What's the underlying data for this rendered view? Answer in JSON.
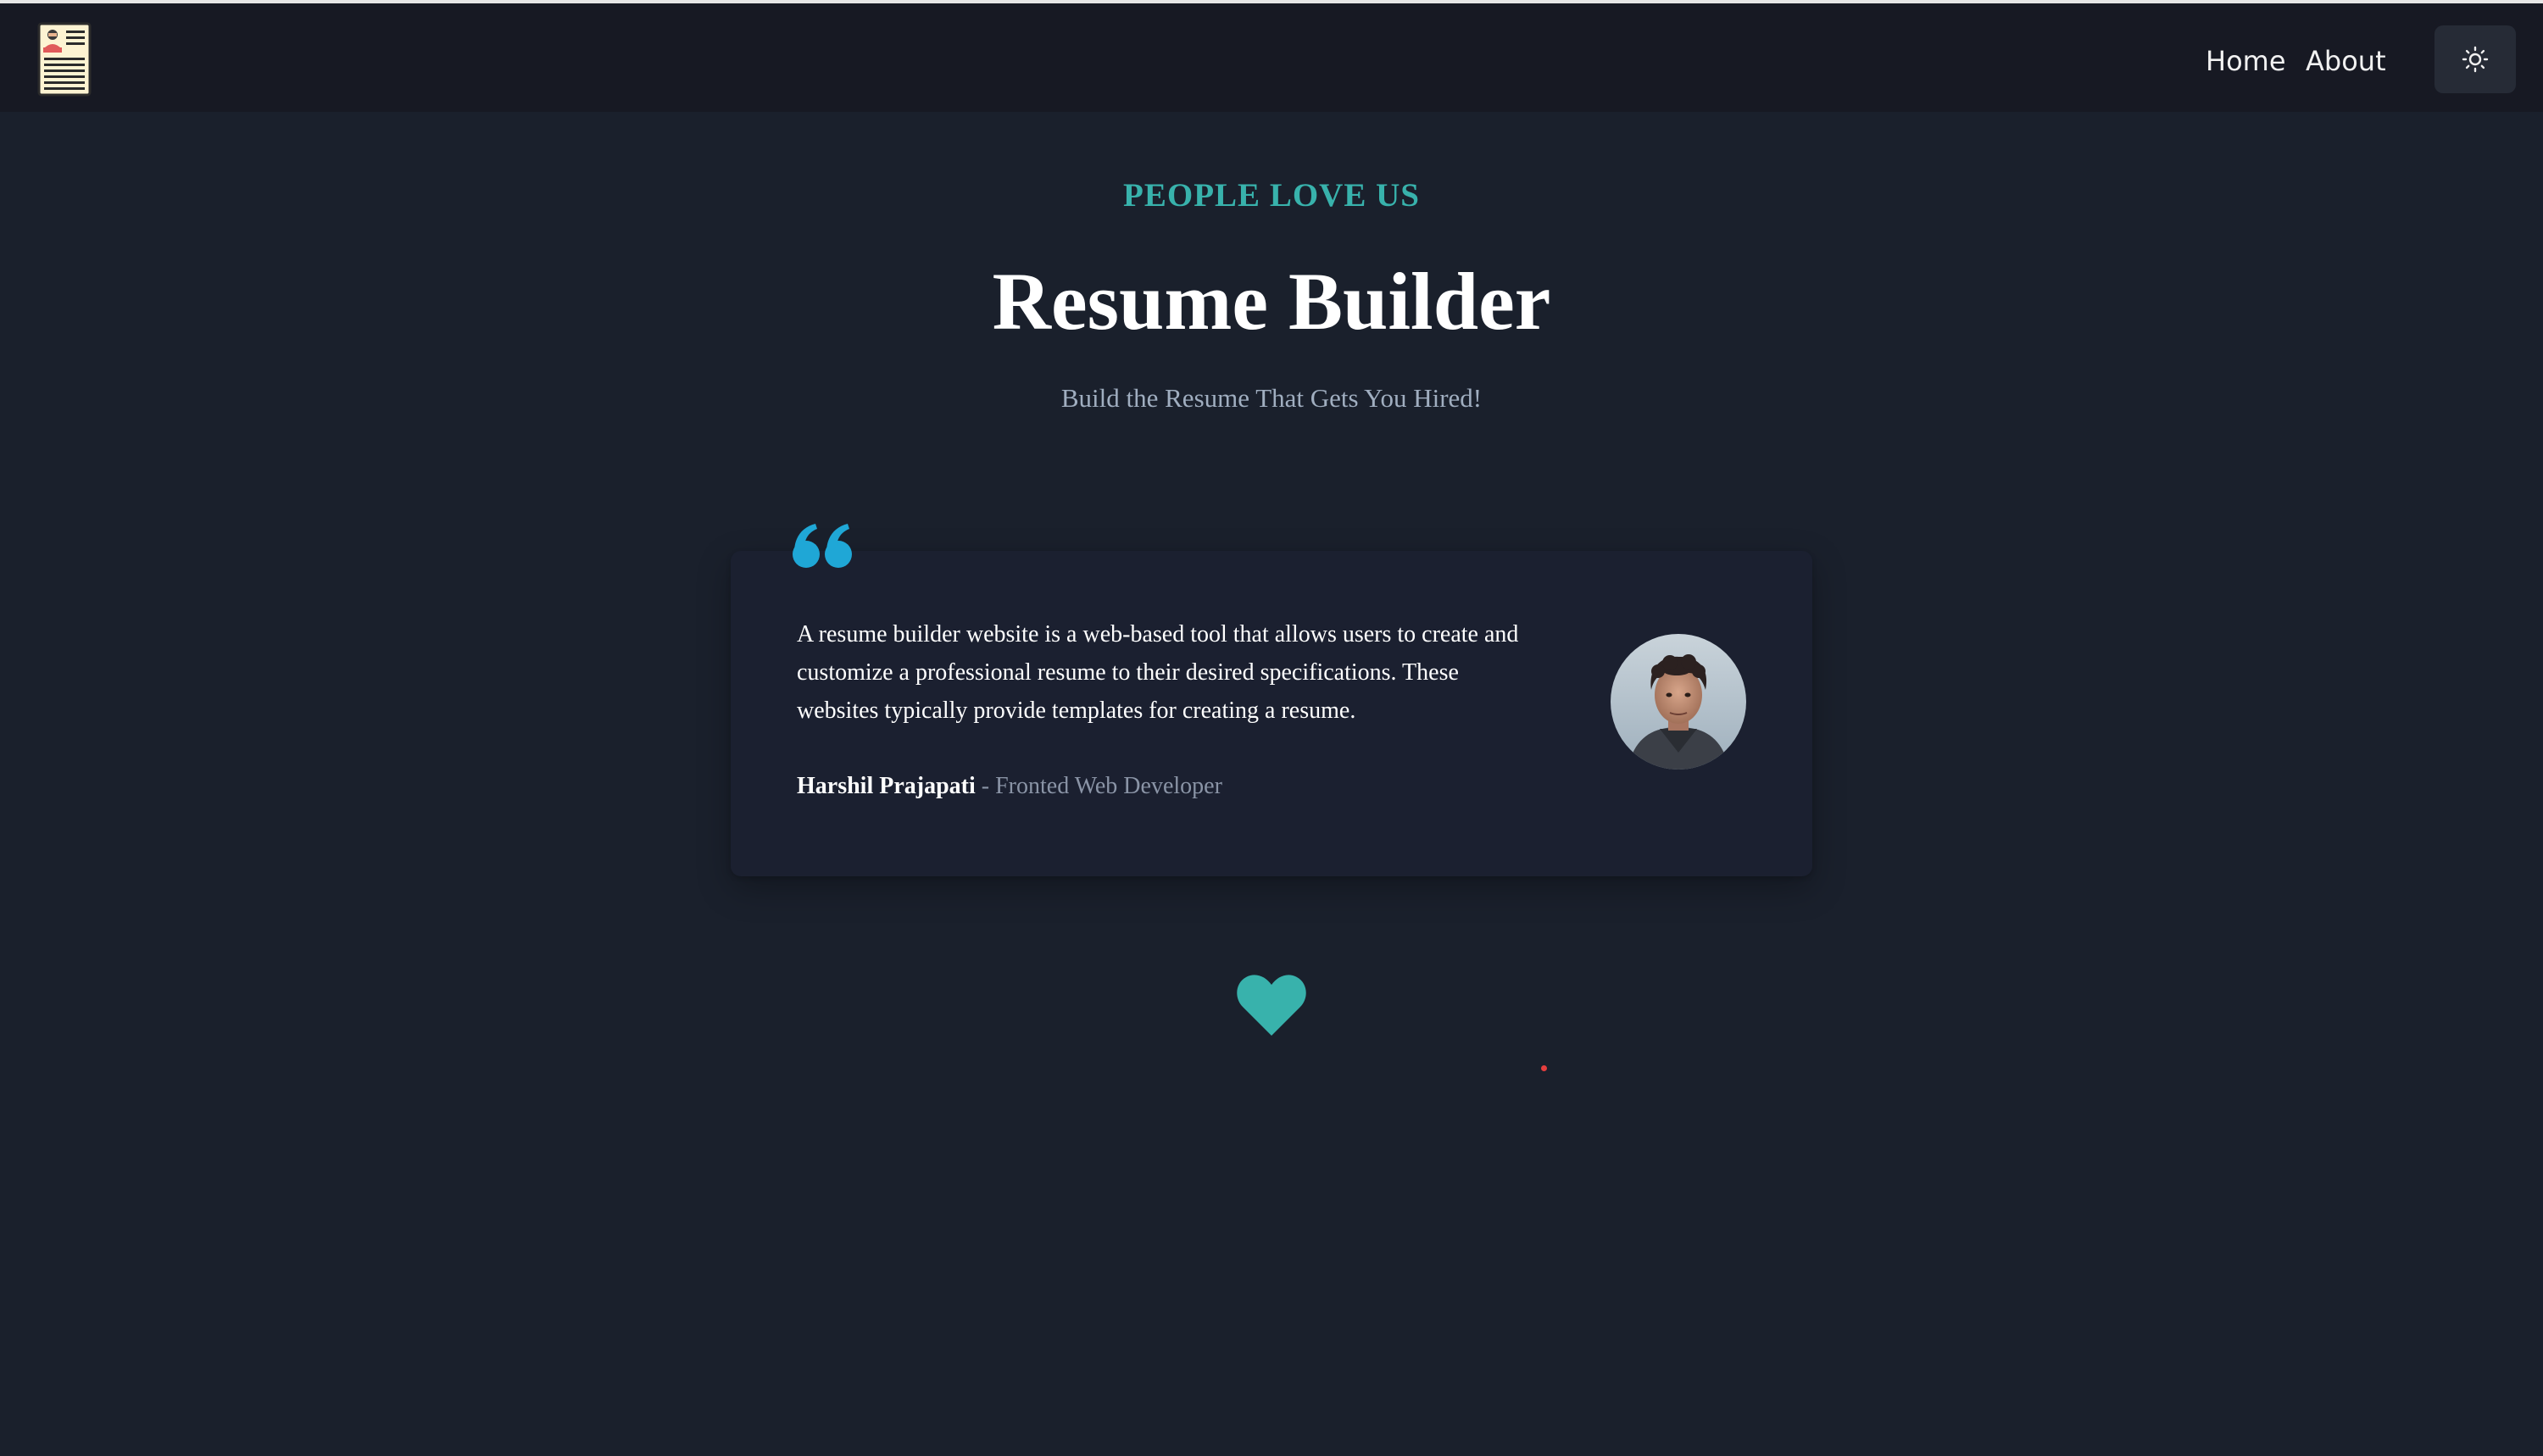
{
  "nav": {
    "logo_icon": "resume-document-icon",
    "home_label": "Home",
    "about_label": "About",
    "theme_toggle_icon": "sun-icon"
  },
  "hero": {
    "eyebrow": "PEOPLE LOVE US",
    "title": "Resume Builder",
    "subtitle": "Build the Resume That Gets You Hired!"
  },
  "testimonial": {
    "quote_icon": "quote-open-icon",
    "text": "A resume builder website is a web-based tool that allows users to create and customize a professional resume to their desired specifications. These websites typically provide templates for creating a resume.",
    "author_name": "Harshil Prajapati",
    "separator": " - ",
    "author_role": "Fronted Web Developer",
    "avatar": "author-avatar-photo"
  },
  "footer": {
    "heart_icon": "heart-icon"
  },
  "colors": {
    "background": "#1a202c",
    "navbar": "#171923",
    "accent_teal": "#38b2ac",
    "quote_blue": "#1fa7d6",
    "muted_text": "#a0aec0"
  }
}
